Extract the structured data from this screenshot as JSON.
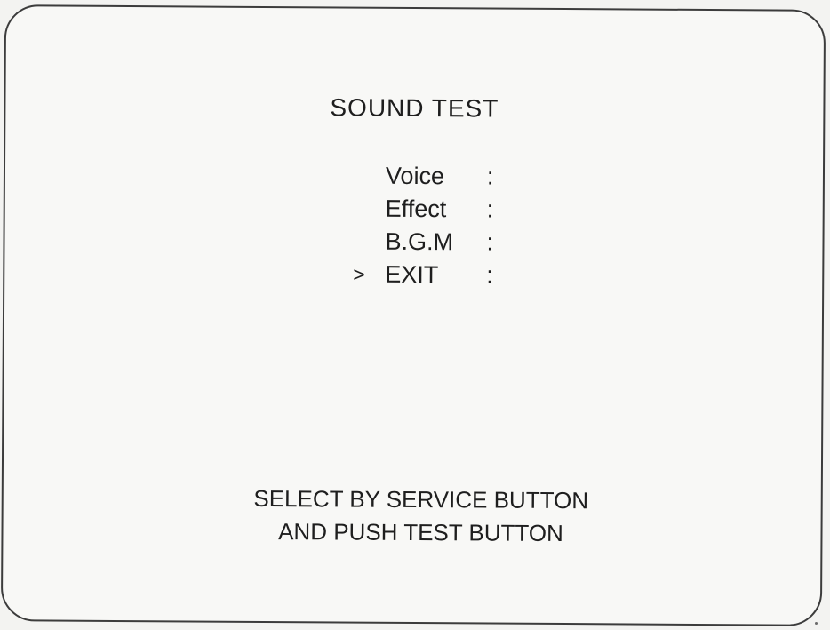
{
  "screen": {
    "title": "SOUND TEST",
    "menu": {
      "items": [
        {
          "cursor": "",
          "label": "Voice",
          "separator": ":"
        },
        {
          "cursor": "",
          "label": "Effect",
          "separator": ":"
        },
        {
          "cursor": "",
          "label": "B.G.M",
          "separator": ":"
        },
        {
          "cursor": ">",
          "label": "EXIT",
          "separator": ":"
        }
      ]
    },
    "instructions": {
      "line1": "SELECT BY SERVICE BUTTON",
      "line2": "AND PUSH TEST BUTTON"
    }
  }
}
